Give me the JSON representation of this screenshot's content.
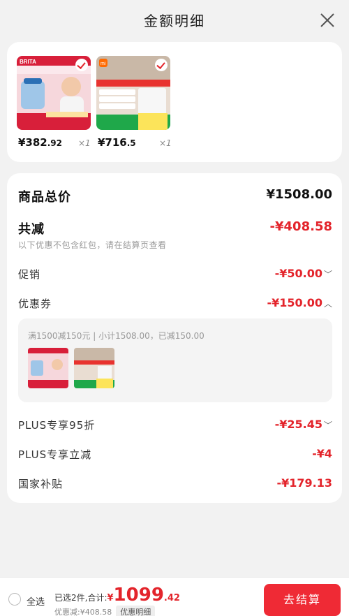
{
  "header": {
    "title": "金额明细"
  },
  "products": [
    {
      "brand": "BRITA",
      "price_int": "¥382",
      "price_dec": ".92",
      "qty": "×1"
    },
    {
      "brand": "mi",
      "price_int": "¥716",
      "price_dec": ".5",
      "qty": "×1"
    }
  ],
  "summary": {
    "goods_total_label": "商品总价",
    "goods_total_value": "¥1508.00",
    "total_off_label": "共减",
    "total_off_value": "-¥408.58",
    "note": "以下优惠不包含红包，请在结算页查看",
    "promo_label": "促销",
    "promo_value": "-¥50.00",
    "coupon_label": "优惠券",
    "coupon_value": "-¥150.00",
    "coupon_detail": "满1500减150元 | 小计1508.00，已减150.00",
    "plus95_label": "PLUS专享95折",
    "plus95_value": "-¥25.45",
    "plus_instant_label": "PLUS专享立减",
    "plus_instant_value": "-¥4",
    "subsidy_label": "国家补贴",
    "subsidy_value": "-¥179.13"
  },
  "bottom_bar": {
    "select_all": "全选",
    "selected_summary": "已选2件,合计:",
    "yen": "¥",
    "total_int": "1099",
    "total_dec": ".42",
    "discount_text": "优惠减:¥408.58",
    "detail_tag": "优惠明细",
    "checkout": "去结算"
  },
  "colors": {
    "accent_red": "#e3242b",
    "checkout_bg": "#ef2a35",
    "page_bg": "#f2f2f2"
  }
}
